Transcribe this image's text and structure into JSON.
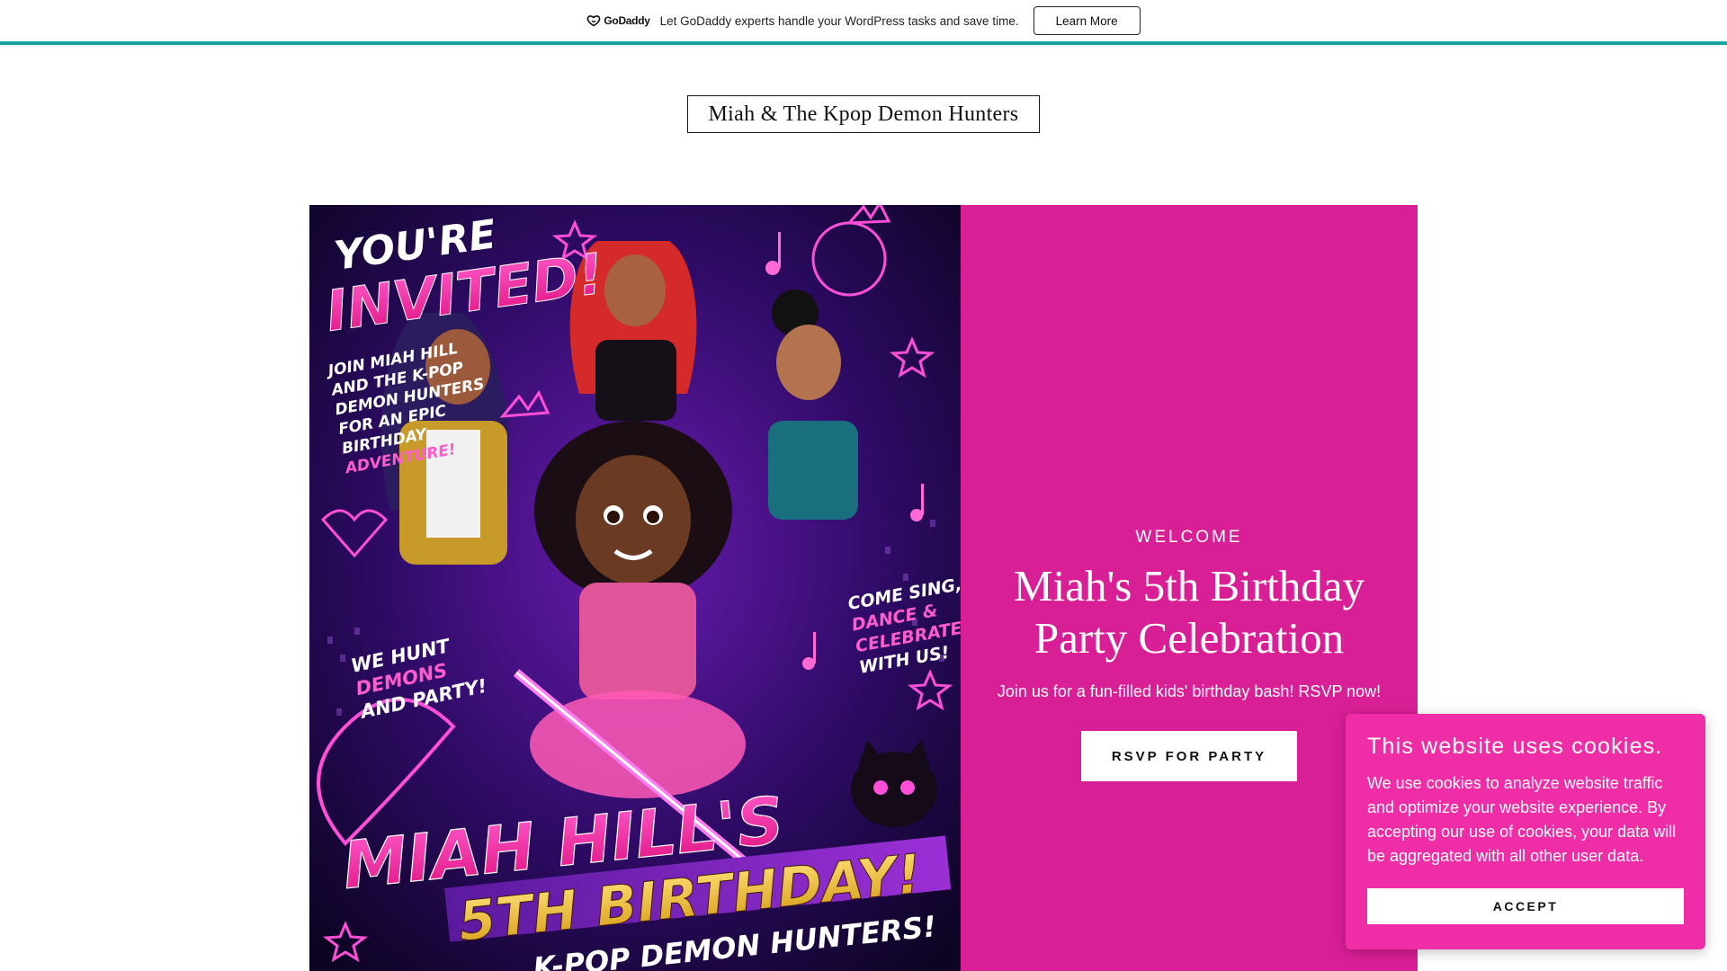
{
  "promo": {
    "logo_text": "GoDaddy",
    "message": "Let GoDaddy experts handle your WordPress tasks and save time.",
    "button_label": "Learn More",
    "accent_color": "#13a3a1"
  },
  "site": {
    "title": "Miah & The Kpop Demon Hunters"
  },
  "hero": {
    "eyebrow": "WELCOME",
    "heading": "Miah's 5th Birthday Party Celebration",
    "subheading": "Join us for a fun-filled kids' birthday bash! RSVP now!",
    "cta_label": "RSVP FOR PARTY",
    "panel_color": "#d91f96",
    "poster": {
      "youre": "YOU'RE",
      "invited": "INVITED!",
      "join_lines": [
        "JOIN MIAH HILL",
        "AND THE K-POP",
        "DEMON HUNTERS",
        "FOR AN EPIC",
        "BIRTHDAY",
        "ADVENTURE!"
      ],
      "heart_lines": [
        "WE HUNT",
        "DEMONS",
        "AND PARTY!"
      ],
      "come_lines": [
        "COME SING,",
        "DANCE &",
        "CELEBRATE",
        "WITH US!"
      ],
      "name": "MIAH HILL'S",
      "birthday": "5TH BIRTHDAY!",
      "tagline": "K-POP DEMON HUNTERS!"
    }
  },
  "cookie": {
    "title": "This website uses cookies.",
    "body": "We use cookies to analyze website traffic and optimize your website experience. By accepting our use of cookies, your data will be aggregated with all other user data.",
    "accept_label": "ACCEPT",
    "bg_color": "#ef2da6"
  }
}
